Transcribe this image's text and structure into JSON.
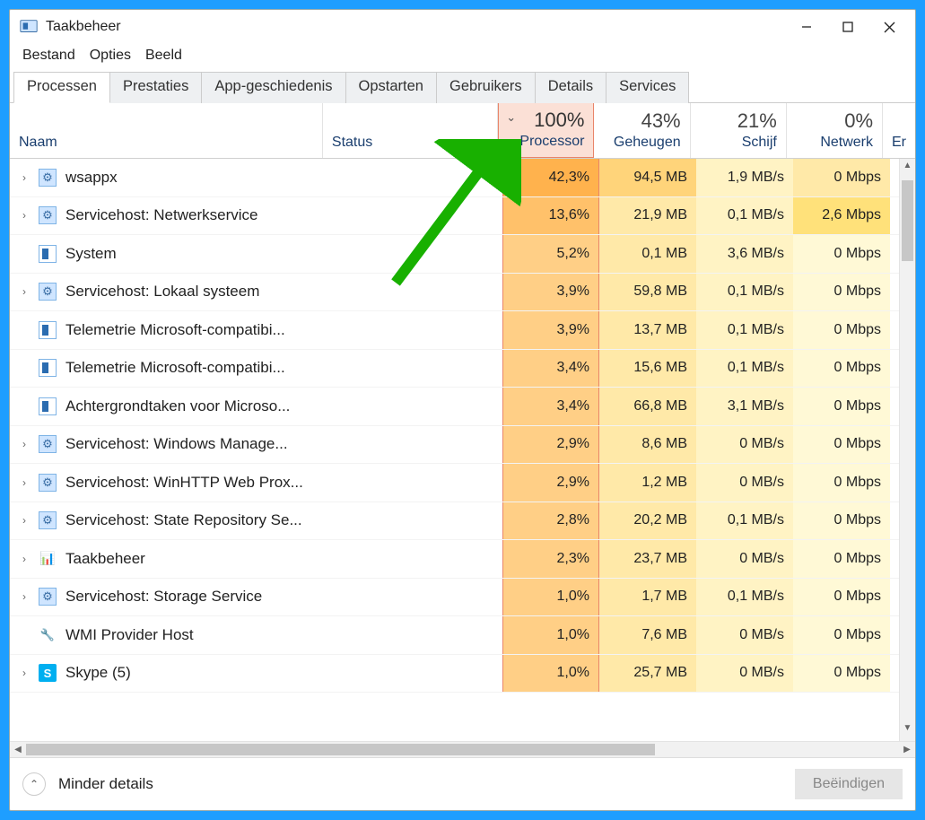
{
  "window": {
    "title": "Taakbeheer"
  },
  "menu": {
    "file": "Bestand",
    "options": "Opties",
    "view": "Beeld"
  },
  "tabs": {
    "processes": "Processen",
    "performance": "Prestaties",
    "history": "App-geschiedenis",
    "startup": "Opstarten",
    "users": "Gebruikers",
    "details": "Details",
    "services": "Services"
  },
  "columns": {
    "name": "Naam",
    "status": "Status",
    "cpu": {
      "usage": "100%",
      "label": "Processor"
    },
    "mem": {
      "usage": "43%",
      "label": "Geheugen"
    },
    "disk": {
      "usage": "21%",
      "label": "Schijf"
    },
    "net": {
      "usage": "0%",
      "label": "Netwerk"
    },
    "extra": "Er"
  },
  "rows": [
    {
      "exp": true,
      "icon": "gear",
      "name": "wsappx",
      "cpu": "42,3%",
      "mem": "94,5 MB",
      "disk": "1,9 MB/s",
      "net": "0 Mbps"
    },
    {
      "exp": true,
      "icon": "gear",
      "name": "Servicehost: Netwerkservice",
      "cpu": "13,6%",
      "mem": "21,9 MB",
      "disk": "0,1 MB/s",
      "net": "2,6 Mbps"
    },
    {
      "exp": false,
      "icon": "sys",
      "name": "System",
      "cpu": "5,2%",
      "mem": "0,1 MB",
      "disk": "3,6 MB/s",
      "net": "0 Mbps"
    },
    {
      "exp": true,
      "icon": "gear",
      "name": "Servicehost: Lokaal systeem",
      "cpu": "3,9%",
      "mem": "59,8 MB",
      "disk": "0,1 MB/s",
      "net": "0 Mbps"
    },
    {
      "exp": false,
      "icon": "sys",
      "name": "Telemetrie Microsoft-compatibi...",
      "cpu": "3,9%",
      "mem": "13,7 MB",
      "disk": "0,1 MB/s",
      "net": "0 Mbps"
    },
    {
      "exp": false,
      "icon": "sys",
      "name": "Telemetrie Microsoft-compatibi...",
      "cpu": "3,4%",
      "mem": "15,6 MB",
      "disk": "0,1 MB/s",
      "net": "0 Mbps"
    },
    {
      "exp": false,
      "icon": "sys",
      "name": "Achtergrondtaken voor Microso...",
      "cpu": "3,4%",
      "mem": "66,8 MB",
      "disk": "3,1 MB/s",
      "net": "0 Mbps"
    },
    {
      "exp": true,
      "icon": "gear",
      "name": "Servicehost: Windows Manage...",
      "cpu": "2,9%",
      "mem": "8,6 MB",
      "disk": "0 MB/s",
      "net": "0 Mbps"
    },
    {
      "exp": true,
      "icon": "gear",
      "name": "Servicehost: WinHTTP Web Prox...",
      "cpu": "2,9%",
      "mem": "1,2 MB",
      "disk": "0 MB/s",
      "net": "0 Mbps"
    },
    {
      "exp": true,
      "icon": "gear",
      "name": "Servicehost: State Repository Se...",
      "cpu": "2,8%",
      "mem": "20,2 MB",
      "disk": "0,1 MB/s",
      "net": "0 Mbps"
    },
    {
      "exp": true,
      "icon": "tm",
      "name": "Taakbeheer",
      "cpu": "2,3%",
      "mem": "23,7 MB",
      "disk": "0 MB/s",
      "net": "0 Mbps"
    },
    {
      "exp": true,
      "icon": "gear",
      "name": "Servicehost: Storage Service",
      "cpu": "1,0%",
      "mem": "1,7 MB",
      "disk": "0,1 MB/s",
      "net": "0 Mbps"
    },
    {
      "exp": false,
      "icon": "wmi",
      "name": "WMI Provider Host",
      "cpu": "1,0%",
      "mem": "7,6 MB",
      "disk": "0 MB/s",
      "net": "0 Mbps"
    },
    {
      "exp": true,
      "icon": "skype",
      "name": "Skype (5)",
      "cpu": "1,0%",
      "mem": "25,7 MB",
      "disk": "0 MB/s",
      "net": "0 Mbps"
    }
  ],
  "footer": {
    "fewer": "Minder details",
    "end": "Beëindigen"
  }
}
